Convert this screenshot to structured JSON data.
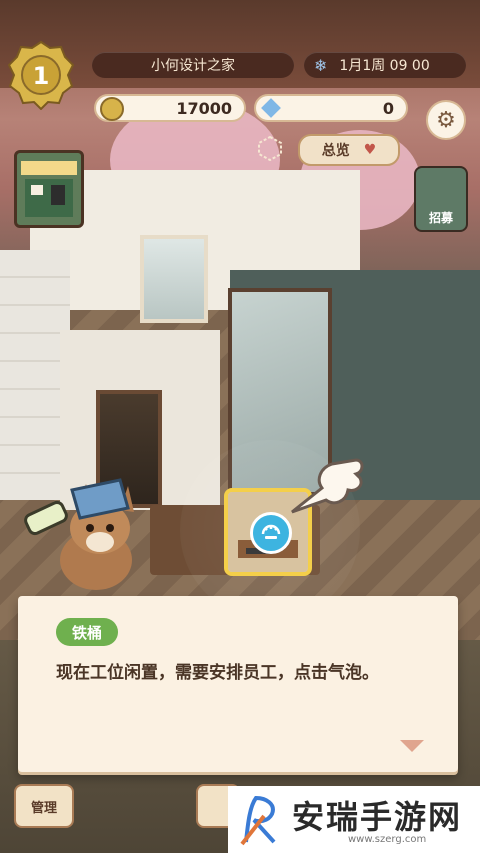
{
  "header": {
    "level": "1",
    "home_name": "小何设计之家",
    "date_time": "1月1周  09 00",
    "coins": "17000",
    "gems": "0",
    "overview_label": "总览"
  },
  "side_buttons": {
    "recruit_label": "招募"
  },
  "dialog": {
    "speaker": "铁桶",
    "message": "现在工位闲置，需要安排员工，点击气泡。"
  },
  "bottom": {
    "manage_label": "管理"
  },
  "watermark": {
    "title": "安瑞手游网",
    "url": "www.szerg.com"
  },
  "colors": {
    "accent_green": "#6fb04e",
    "dialog_bg": "#fbf1e2",
    "bubble_blue": "#3db4e0",
    "highlight_yellow": "#f4cf4a"
  }
}
